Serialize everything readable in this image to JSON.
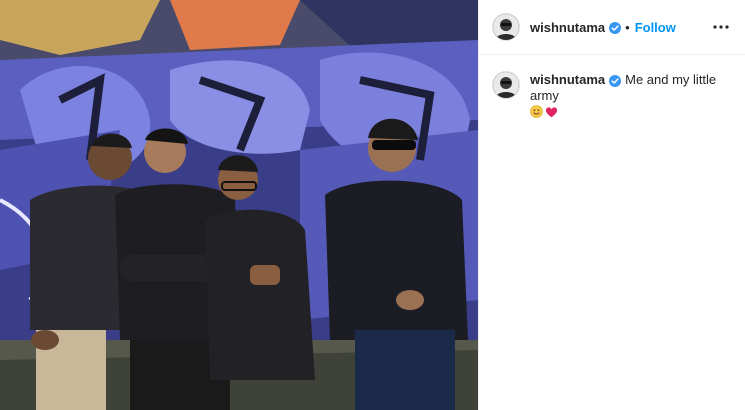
{
  "post": {
    "image_icon": "group-photo-graffiti",
    "header": {
      "username": "wishnutama",
      "verified_icon": "verified-badge-icon",
      "separator": "•",
      "follow_label": "Follow",
      "more_icon": "more-options-icon"
    },
    "caption": {
      "username": "wishnutama",
      "verified_icon": "verified-badge-icon",
      "text": "Me and my little army",
      "emojis": [
        "smiling-face-icon",
        "red-heart-icon"
      ]
    }
  },
  "colors": {
    "follow": "#0095f6",
    "verified": "#3897f0",
    "text": "#262626",
    "divider": "#efefef"
  }
}
